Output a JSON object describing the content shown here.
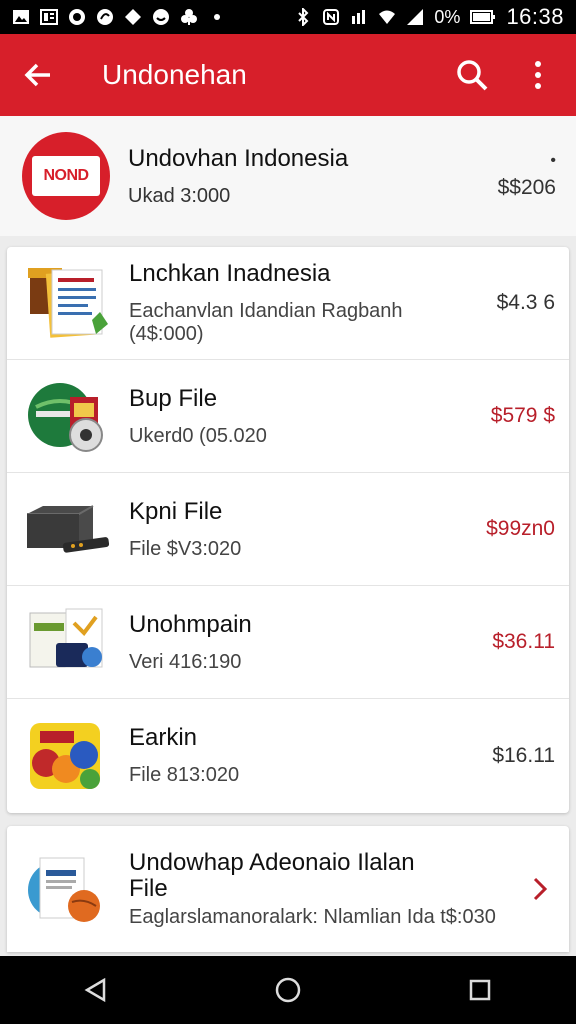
{
  "status_bar": {
    "battery": "0%",
    "time": "16:38"
  },
  "app_bar": {
    "title": "Undonehan",
    "back_icon": "arrow-back-icon",
    "search_icon": "search-icon",
    "more_icon": "more-vert-icon"
  },
  "header": {
    "logo_text": "NOND",
    "name": "Undovhan Indonesia",
    "subtitle": "Ukad 3:000",
    "price": "$$206",
    "dot": "•"
  },
  "list": [
    {
      "title": "Lnchkan Inadnesia",
      "subtitle": "Eachanvlan Idandian Ragbanh (4$:000)",
      "price": "$4.3 6",
      "price_color": "#333333",
      "thumb": "document-stack"
    },
    {
      "title": "Bup File",
      "subtitle": "Ukerd0 (05.020",
      "price": "$579 $",
      "price_color": "#b81f2a",
      "thumb": "globe-box"
    },
    {
      "title": "Kpni File",
      "subtitle": "File $V3:020",
      "price": "$99zn0",
      "price_color": "#b81f2a",
      "thumb": "router-device"
    },
    {
      "title": "Unohmpain",
      "subtitle": "Veri 416:190",
      "price": "$36.11",
      "price_color": "#b81f2a",
      "thumb": "software-box"
    },
    {
      "title": "Earkin",
      "subtitle": "File 813:020",
      "price": "$16.11",
      "price_color": "#333333",
      "thumb": "fruits-package"
    }
  ],
  "bottom_card": {
    "title_line1": "Undowhap Adeonaio Ilalan",
    "title_line2": "File",
    "subtitle": "Eaglarslamanoralark: Nlamlian Ida t$:030",
    "chevron_icon": "chevron-right-icon",
    "thumb": "document-ball"
  },
  "nav": {
    "back": "back-triangle-icon",
    "home": "home-circle-icon",
    "recents": "recents-square-icon"
  },
  "colors": {
    "accent": "#d71f2a",
    "price_red": "#b81f2a"
  }
}
